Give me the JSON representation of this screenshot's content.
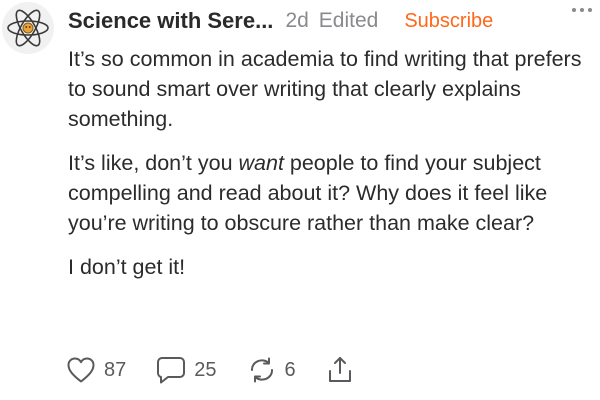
{
  "post": {
    "author": "Science with Sere...",
    "time": "2d",
    "edited": "Edited",
    "subscribe_label": "Subscribe",
    "paragraphs": {
      "p1": "It’s so common in academia to find writing that prefers to sound smart over writing that clearly explains something.",
      "p2_before": "It’s like, don’t you ",
      "p2_emph": "want",
      "p2_after": " people to find your subject compelling and read about it? Why does it feel like you’re writing to obscure rather than make clear?",
      "p3": "I don’t get it!"
    },
    "actions": {
      "like_count": "87",
      "comment_count": "25",
      "restack_count": "6"
    },
    "icons": {
      "avatar": "atom-logo",
      "like": "heart-icon",
      "comment": "comment-bubble-icon",
      "restack": "restack-icon",
      "share": "share-icon",
      "more": "more-dots-icon"
    },
    "colors": {
      "accent": "#ff6719",
      "meta": "#8a8a8e"
    }
  }
}
